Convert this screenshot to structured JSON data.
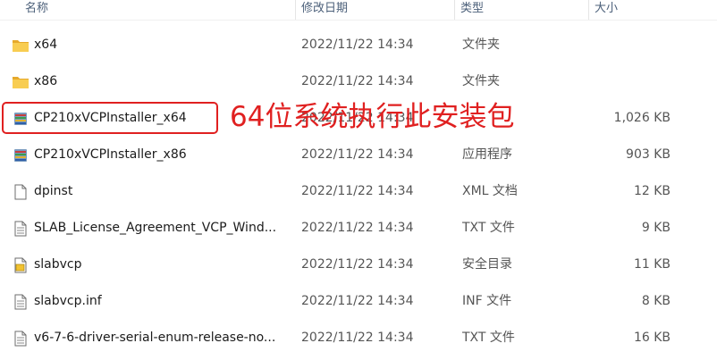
{
  "columns": {
    "name": "名称",
    "date": "修改日期",
    "type": "类型",
    "size": "大小"
  },
  "files": [
    {
      "name": "x64",
      "date": "2022/11/22 14:34",
      "type": "文件夹",
      "size": "",
      "icon": "folder-icon"
    },
    {
      "name": "x86",
      "date": "2022/11/22 14:34",
      "type": "文件夹",
      "size": "",
      "icon": "folder-icon"
    },
    {
      "name": "CP210xVCPInstaller_x64",
      "date": "2022/11/22 14:34",
      "type": "",
      "size": "1,026 KB",
      "icon": "installer-icon"
    },
    {
      "name": "CP210xVCPInstaller_x86",
      "date": "2022/11/22 14:34",
      "type": "应用程序",
      "size": "903 KB",
      "icon": "installer-icon"
    },
    {
      "name": "dpinst",
      "date": "2022/11/22 14:34",
      "type": "XML 文档",
      "size": "12 KB",
      "icon": "document-icon"
    },
    {
      "name": "SLAB_License_Agreement_VCP_Wind...",
      "date": "2022/11/22 14:34",
      "type": "TXT 文件",
      "size": "9 KB",
      "icon": "text-file-icon"
    },
    {
      "name": "slabvcp",
      "date": "2022/11/22 14:34",
      "type": "安全目录",
      "size": "11 KB",
      "icon": "security-catalog-icon"
    },
    {
      "name": "slabvcp.inf",
      "date": "2022/11/22 14:34",
      "type": "INF 文件",
      "size": "8 KB",
      "icon": "text-file-icon"
    },
    {
      "name": "v6-7-6-driver-serial-enum-release-no...",
      "date": "2022/11/22 14:34",
      "type": "TXT 文件",
      "size": "16 KB",
      "icon": "text-file-icon"
    }
  ],
  "annotation": {
    "text": "64位系统执行此安装包",
    "color": "#e02020"
  },
  "colors": {
    "folder": "#f5c342",
    "header_text": "#4c607a",
    "highlight": "#e02020"
  }
}
